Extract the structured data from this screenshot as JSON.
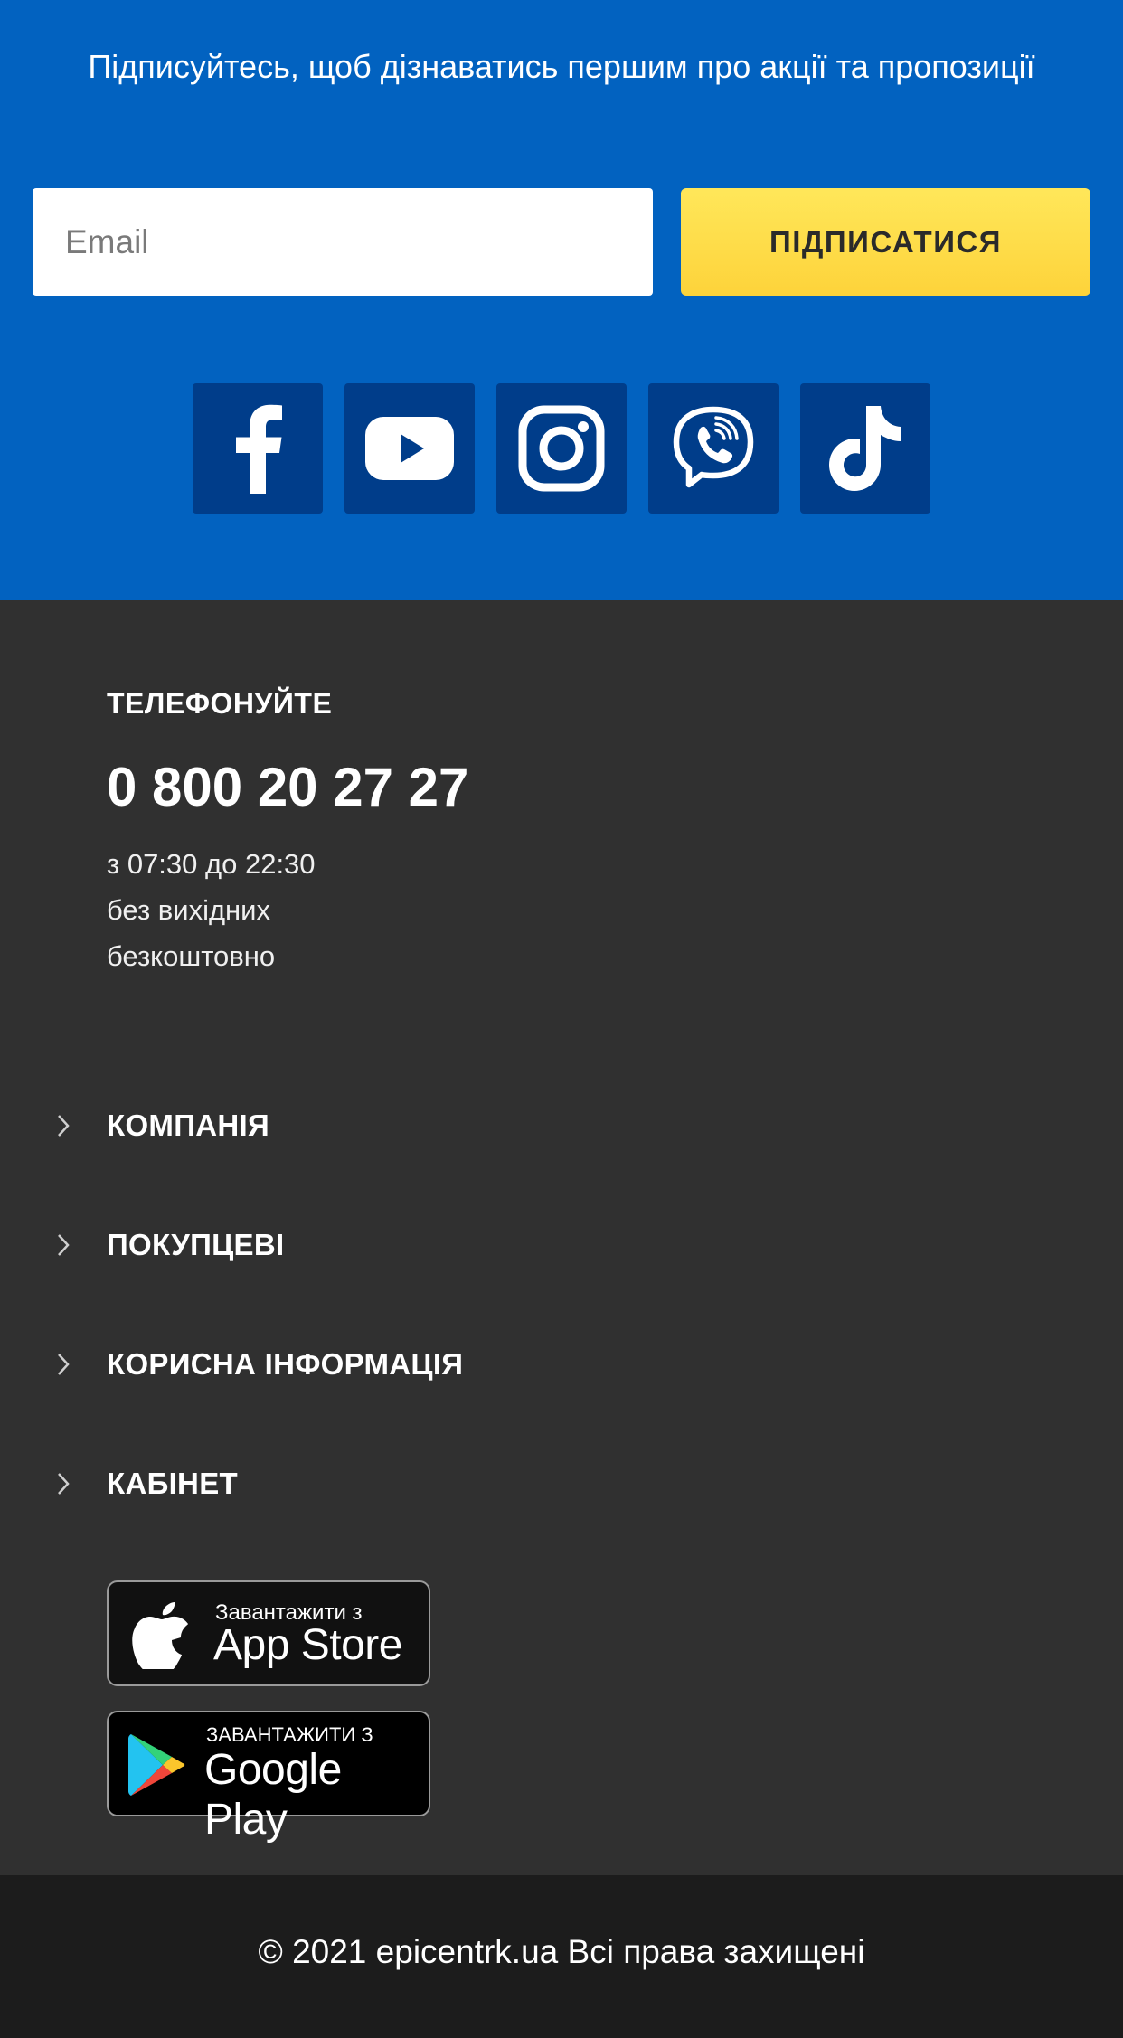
{
  "subscribe": {
    "text": "Підписуйтесь, щоб дізнаватись першим про акції та пропозиції",
    "email_placeholder": "Email",
    "button_label": "ПІДПИСАТИСЯ",
    "background_color": "#0262c0",
    "button_color": "#fdd33a"
  },
  "socials": [
    {
      "name": "facebook",
      "icon": "facebook-icon"
    },
    {
      "name": "youtube",
      "icon": "youtube-icon"
    },
    {
      "name": "instagram",
      "icon": "instagram-icon"
    },
    {
      "name": "viber",
      "icon": "viber-icon"
    },
    {
      "name": "tiktok",
      "icon": "tiktok-icon"
    }
  ],
  "contact": {
    "title": "ТЕЛЕФОНУЙТЕ",
    "phone": "0 800 20 27 27",
    "hours": "з 07:30 до 22:30",
    "days": "без вихідних",
    "cost": "безкоштовно"
  },
  "menu": [
    {
      "label": "КОМПАНІЯ",
      "icon": "chevron-right-icon"
    },
    {
      "label": "ПОКУПЦЕВІ",
      "icon": "chevron-right-icon"
    },
    {
      "label": "КОРИСНА ІНФОРМАЦІЯ",
      "icon": "chevron-right-icon"
    },
    {
      "label": "КАБІНЕТ",
      "icon": "chevron-right-icon"
    }
  ],
  "apps": {
    "app_store": {
      "small": "Завантажити з",
      "big": "App Store",
      "icon": "apple-icon"
    },
    "google_play": {
      "small": "ЗАВАНТАЖИТИ З",
      "big": "Google Play",
      "icon": "google-play-icon"
    }
  },
  "footer": {
    "copyright": "© 2021 epicentrk.ua Всі права захищені"
  }
}
